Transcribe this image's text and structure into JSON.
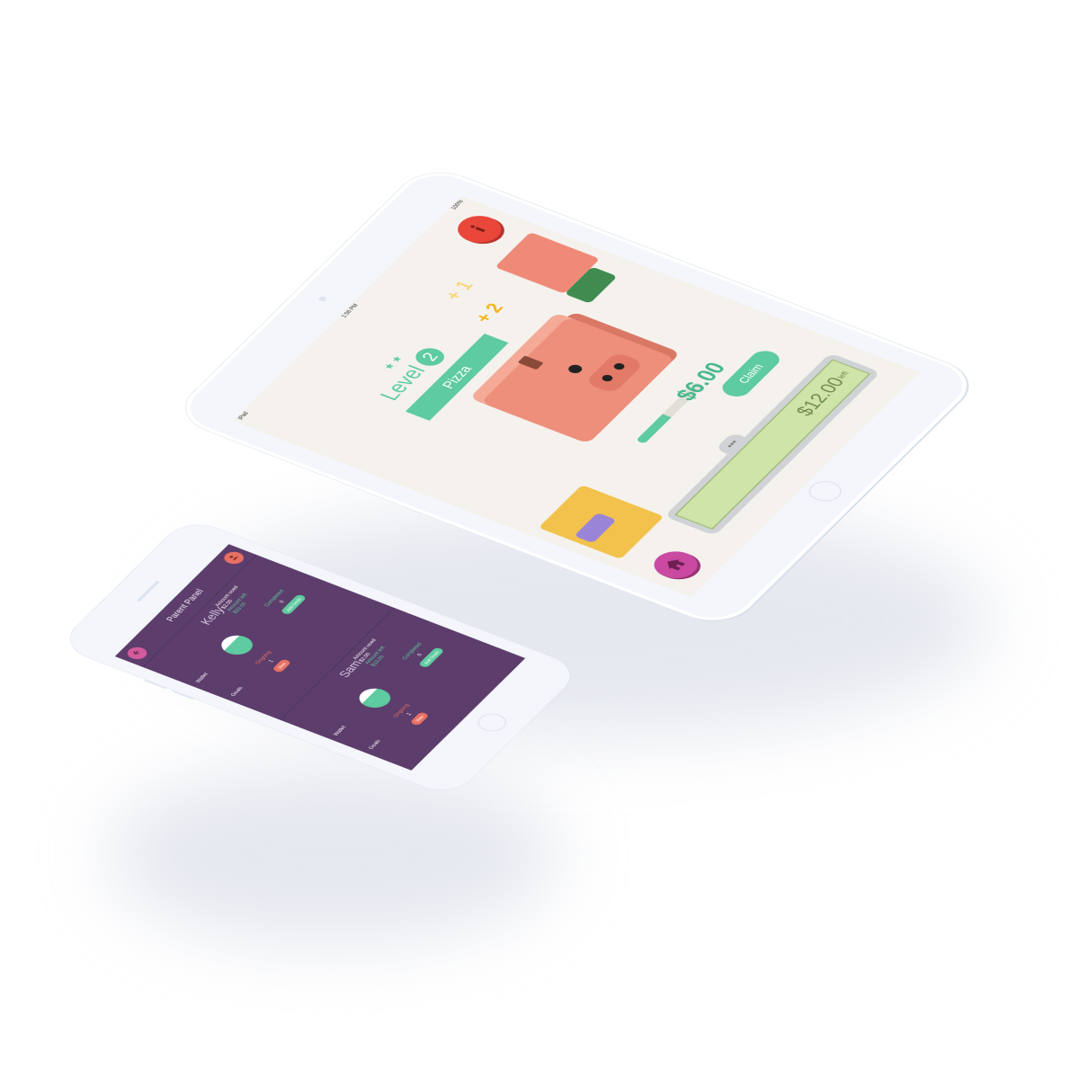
{
  "tablet": {
    "status": {
      "left": "iPad",
      "time": "1:56 PM",
      "battery": "100%"
    },
    "buttons": {
      "info_icon": "info-icon",
      "home_icon": "home-icon"
    },
    "level": {
      "label": "Level",
      "number": "2"
    },
    "goal_name": "Pizza",
    "bonus": {
      "plus1": "+ 1",
      "plus2": "+ 2"
    },
    "progress_fraction": 0.45,
    "amount": "$6.00",
    "claim_label": "Claim",
    "money": {
      "amount": "$12.00",
      "suffix": "left"
    },
    "chat_dots": "•••",
    "colors": {
      "accent": "#5ecba0",
      "info": "#e8473a",
      "home": "#c94aa0",
      "pig": "#ee8f7b",
      "background": "#f5f2ee"
    }
  },
  "phone": {
    "title": "Parent Panel",
    "back_icon": "back-arrow-icon",
    "avatar_icon": "avatar-icon",
    "children": [
      {
        "name": "Kelly",
        "amount_used_label": "Amount used",
        "amount_used": "$2.00",
        "amount_left_label": "Amount left",
        "amount_left": "$33.00",
        "wallet_label": "Wallet",
        "completed_label": "Completed",
        "completed_count": "0",
        "completed_btn": "Add Goals",
        "goals_label": "Goals",
        "ongoing_label": "Ongoing",
        "ongoing_count": "1",
        "ongoing_btn": "View"
      },
      {
        "name": "Sam",
        "amount_used_label": "Amount used",
        "amount_used": "$2.00",
        "amount_left_label": "Amount left",
        "amount_left": "$13.00",
        "wallet_label": "Wallet",
        "completed_label": "Completed",
        "completed_count": "0",
        "completed_btn": "Add Goals",
        "goals_label": "Goals",
        "ongoing_label": "Ongoing",
        "ongoing_count": "1",
        "ongoing_btn": "View"
      }
    ],
    "colors": {
      "background": "#5c3d6b",
      "accent": "#5ecba0",
      "alert": "#e87063"
    }
  }
}
